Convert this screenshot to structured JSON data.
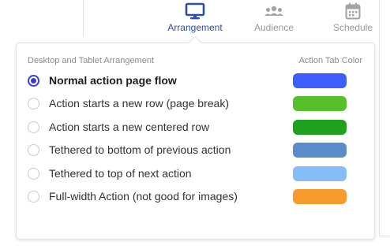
{
  "tabs": [
    {
      "label": "Arrangement",
      "icon": "monitor-icon",
      "active": true
    },
    {
      "label": "Audience",
      "icon": "group-icon",
      "active": false
    },
    {
      "label": "Schedule",
      "icon": "calendar-icon",
      "active": false
    }
  ],
  "panel": {
    "section_title": "Desktop and Tablet Arrangement",
    "color_header": "Action Tab Color",
    "options": [
      {
        "label": "Normal action page flow",
        "selected": true,
        "color": "#3b5efc"
      },
      {
        "label": "Action starts a new row (page break)",
        "selected": false,
        "color": "#55bf2c"
      },
      {
        "label": "Action starts a new centered row",
        "selected": false,
        "color": "#1ea21e"
      },
      {
        "label": "Tethered to bottom of previous action",
        "selected": false,
        "color": "#5a8ccc"
      },
      {
        "label": "Tethered to top of next action",
        "selected": false,
        "color": "#86bdf6"
      },
      {
        "label": "Full-width Action (not good for images)",
        "selected": false,
        "color": "#f99a2c"
      }
    ]
  },
  "colors": {
    "active_tab": "#2f4fa3",
    "inactive_tab": "#9a9a9a",
    "radio_selected": "#3a3fcf"
  }
}
